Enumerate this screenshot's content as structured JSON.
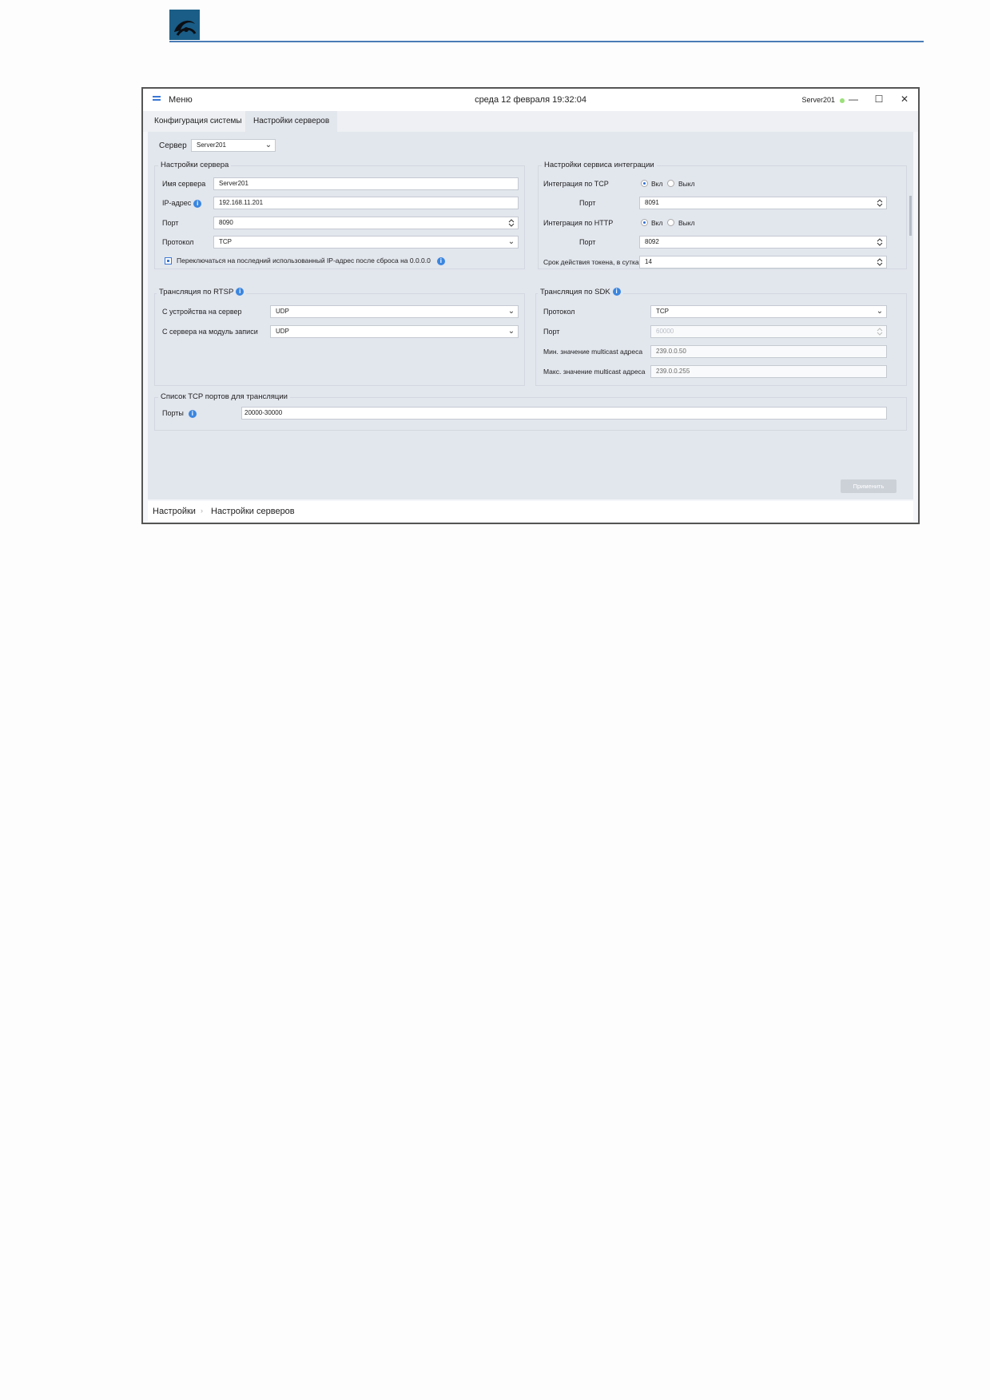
{
  "window": {
    "menu_label": "Меню",
    "datetime": "среда 12 февраля 19:32:04",
    "server_name": "Server201",
    "controls": {
      "minimize": "—",
      "maximize": "☐",
      "close": "✕"
    }
  },
  "tabs": [
    {
      "label": "Конфигурация системы",
      "active": false
    },
    {
      "label": "Настройки серверов",
      "active": true
    }
  ],
  "server_select": {
    "label": "Сервер",
    "value": "Server201"
  },
  "server_settings": {
    "title": "Настройки сервера",
    "name_label": "Имя сервера",
    "name_value": "Server201",
    "ip_label": "IP-адрес",
    "ip_value": "192.168.11.201",
    "port_label": "Порт",
    "port_value": "8090",
    "protocol_label": "Протокол",
    "protocol_value": "TCP",
    "switch_checkbox_label": "Переключаться на последний использованный IP-адрес после сброса на 0.0.0.0"
  },
  "integration": {
    "title": "Настройки сервиса интеграции",
    "tcp_label": "Интеграция по TCP",
    "tcp_on": "Вкл",
    "tcp_off": "Выкл",
    "tcp_port_label": "Порт",
    "tcp_port_value": "8091",
    "http_label": "Интеграция по HTTP",
    "http_on": "Вкл",
    "http_off": "Выкл",
    "http_port_label": "Порт",
    "http_port_value": "8092",
    "token_label": "Срок действия токена, в сутках",
    "token_value": "14"
  },
  "rtsp": {
    "title": "Трансляция по RTSP",
    "device_to_server_label": "С устройства на сервер",
    "device_to_server_value": "UDP",
    "server_to_recorder_label": "С сервера на модуль записи",
    "server_to_recorder_value": "UDP"
  },
  "sdk": {
    "title": "Трансляция по SDK",
    "protocol_label": "Протокол",
    "protocol_value": "TCP",
    "port_label": "Порт",
    "port_value": "60000",
    "min_multicast_label": "Мин. значение multicast адреса",
    "min_multicast_value": "239.0.0.50",
    "max_multicast_label": "Макс. значение multicast адреса",
    "max_multicast_value": "239.0.0.255"
  },
  "tcp_ports": {
    "title": "Список TCP портов для трансляции",
    "ports_label": "Порты",
    "ports_value": "20000-30000"
  },
  "apply_label": "Применить",
  "breadcrumb": [
    "Настройки",
    "Настройки серверов"
  ],
  "colors": {
    "accent": "#3a86e0",
    "status_online": "#9be07a",
    "window_bg": "#e2e6ed"
  }
}
